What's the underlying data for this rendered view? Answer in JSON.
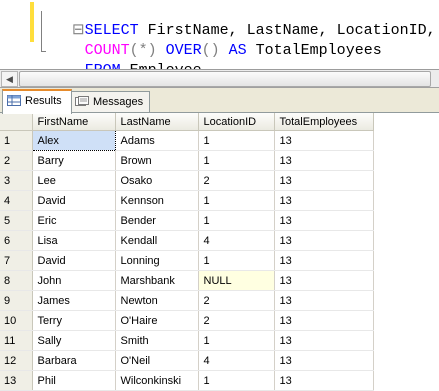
{
  "editor": {
    "line1": {
      "kw1": "SELECT",
      "rest": " FirstName, LastName, LocationID,"
    },
    "line2": {
      "fn": "COUNT",
      "args": "(*)",
      "kw": " OVER",
      "paren": "()",
      "kw2": " AS",
      "rest": " TotalEmployees"
    },
    "line3": {
      "kw": "FROM",
      "rest": " Employee"
    }
  },
  "tabs": {
    "results": "Results",
    "messages": "Messages"
  },
  "grid": {
    "columns": [
      "FirstName",
      "LastName",
      "LocationID",
      "TotalEmployees"
    ],
    "rows": [
      {
        "n": "1",
        "FirstName": "Alex",
        "LastName": "Adams",
        "LocationID": "1",
        "TotalEmployees": "13"
      },
      {
        "n": "2",
        "FirstName": "Barry",
        "LastName": "Brown",
        "LocationID": "1",
        "TotalEmployees": "13"
      },
      {
        "n": "3",
        "FirstName": "Lee",
        "LastName": "Osako",
        "LocationID": "2",
        "TotalEmployees": "13"
      },
      {
        "n": "4",
        "FirstName": "David",
        "LastName": "Kennson",
        "LocationID": "1",
        "TotalEmployees": "13"
      },
      {
        "n": "5",
        "FirstName": "Eric",
        "LastName": "Bender",
        "LocationID": "1",
        "TotalEmployees": "13"
      },
      {
        "n": "6",
        "FirstName": "Lisa",
        "LastName": "Kendall",
        "LocationID": "4",
        "TotalEmployees": "13"
      },
      {
        "n": "7",
        "FirstName": "David",
        "LastName": "Lonning",
        "LocationID": "1",
        "TotalEmployees": "13"
      },
      {
        "n": "8",
        "FirstName": "John",
        "LastName": "Marshbank",
        "LocationID": "NULL",
        "TotalEmployees": "13"
      },
      {
        "n": "9",
        "FirstName": "James",
        "LastName": "Newton",
        "LocationID": "2",
        "TotalEmployees": "13"
      },
      {
        "n": "10",
        "FirstName": "Terry",
        "LastName": "O'Haire",
        "LocationID": "2",
        "TotalEmployees": "13"
      },
      {
        "n": "11",
        "FirstName": "Sally",
        "LastName": "Smith",
        "LocationID": "1",
        "TotalEmployees": "13"
      },
      {
        "n": "12",
        "FirstName": "Barbara",
        "LastName": "O'Neil",
        "LocationID": "4",
        "TotalEmployees": "13"
      },
      {
        "n": "13",
        "FirstName": "Phil",
        "LastName": "Wilconkinski",
        "LocationID": "1",
        "TotalEmployees": "13"
      }
    ]
  },
  "icons": {
    "results_tab_icon": "grid-icon",
    "messages_tab_icon": "message-icon",
    "scroll_left": "arrow-left-icon"
  }
}
